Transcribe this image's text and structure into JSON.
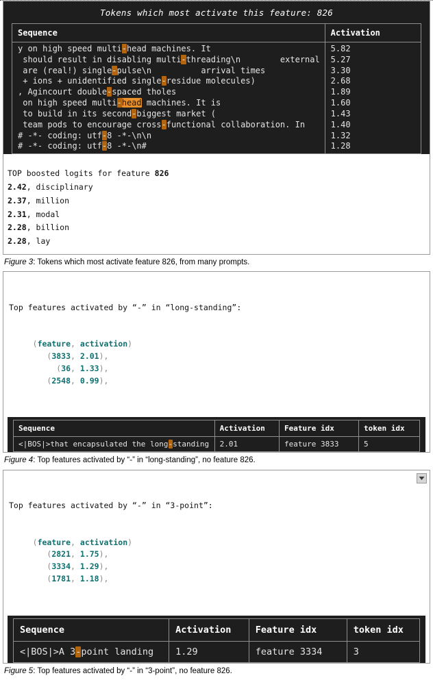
{
  "figure3": {
    "console_title": "Tokens which most activate this feature: 826",
    "table": {
      "columns": [
        "Sequence",
        "Activation"
      ],
      "rows": [
        {
          "pre": "y on high speed multi",
          "sep": "-",
          "sep_style": "dim",
          "post": "head machines. It",
          "activation": "5.82"
        },
        {
          "pre": " should result in disabling multi",
          "sep": "-",
          "sep_style": "dim",
          "post": "threading\\n        external",
          "activation": "5.27"
        },
        {
          "pre": " are (real!) single",
          "sep": "-",
          "sep_style": "dim",
          "post": "pulse\\n          arrival times",
          "activation": "3.30"
        },
        {
          "pre": " + ions + unidentified single",
          "sep": "-",
          "sep_style": "dim",
          "post": "residue molecules)",
          "activation": "2.68"
        },
        {
          "pre": ", Agincourt double",
          "sep": "-",
          "sep_style": "dim",
          "post": "spaced tholes",
          "activation": "1.89"
        },
        {
          "pre": " on high speed multi",
          "sep": "-",
          "sep_style": "dim",
          "post": "",
          "strong": "head",
          "tail": " machines. It is",
          "activation": "1.60"
        },
        {
          "pre": " to build in its second",
          "sep": "-",
          "sep_style": "dim",
          "post": "biggest market (",
          "activation": "1.43"
        },
        {
          "pre": " team pods to encourage cross",
          "sep": "-",
          "sep_style": "dim",
          "post": "functional collaboration. In",
          "activation": "1.40"
        },
        {
          "pre": "# -*- coding: utf",
          "sep": "-",
          "sep_style": "dim",
          "post": "8 -*-\\n\\n",
          "activation": "1.32"
        },
        {
          "pre": "# -*- coding: utf",
          "sep": "-",
          "sep_style": "dim",
          "post": "8 -*-\\n#",
          "activation": "1.28"
        }
      ]
    },
    "logits": {
      "heading_prefix": "TOP boosted logits for feature ",
      "heading_feature": "826",
      "entries": [
        {
          "value": "2.42",
          "token": ", disciplinary"
        },
        {
          "value": "2.37",
          "token": ", million"
        },
        {
          "value": "2.31",
          "token": ", modal"
        },
        {
          "value": "2.28",
          "token": ", billion"
        },
        {
          "value": "2.28",
          "token": ", lay"
        }
      ]
    },
    "caption_label": "Figure 3",
    "caption_text": ": Tokens which most activate feature 826, from many prompts."
  },
  "figure4": {
    "code_heading": "Top features activated by “-” in “long-standing”:",
    "tuple_header": [
      "feature",
      "activation"
    ],
    "tuples": [
      {
        "feature": "3833",
        "activation": "2.01",
        "indent": 8
      },
      {
        "feature": "36",
        "activation": "1.33",
        "indent": 10
      },
      {
        "feature": "2548",
        "activation": "0.99",
        "indent": 8
      }
    ],
    "table": {
      "columns": [
        "Sequence",
        "Activation",
        "Feature idx",
        "token idx"
      ],
      "rows": [
        {
          "seq_pre": "<|BOS|>that encapsulated the long",
          "seq_sep": "-",
          "seq_post": "standing",
          "activation": "2.01",
          "feature_idx": "feature 3833",
          "token_idx": "5"
        }
      ]
    },
    "caption_label": "Figure 4",
    "caption_text": ": Top features activated by “-” in “long-standing”, no feature 826."
  },
  "figure5": {
    "code_heading": "Top features activated by “-” in “3-point”:",
    "tuple_header": [
      "feature",
      "activation"
    ],
    "tuples": [
      {
        "feature": "2821",
        "activation": "1.75",
        "indent": 8
      },
      {
        "feature": "3334",
        "activation": "1.29",
        "indent": 8
      },
      {
        "feature": "1781",
        "activation": "1.18",
        "indent": 8
      }
    ],
    "table": {
      "columns": [
        "Sequence",
        "Activation",
        "Feature idx",
        "token idx"
      ],
      "rows": [
        {
          "seq_pre": "<|BOS|>A 3",
          "seq_sep": "-",
          "seq_post": "point landing",
          "activation": "1.29",
          "feature_idx": "feature 3334",
          "token_idx": "3"
        }
      ]
    },
    "caption_label": "Figure 5",
    "caption_text": ": Top features activated by “-” in “3-point”, no feature 826."
  },
  "colors": {
    "console_bg": "#1e1e1e",
    "highlight_dim": "#b4660f",
    "highlight_strong": "#e8912a",
    "tuple_teal": "#0f7070",
    "panel_border": "#9a9a9a"
  },
  "scrollbar": {
    "arrow_icon": "chevron-down-icon"
  }
}
